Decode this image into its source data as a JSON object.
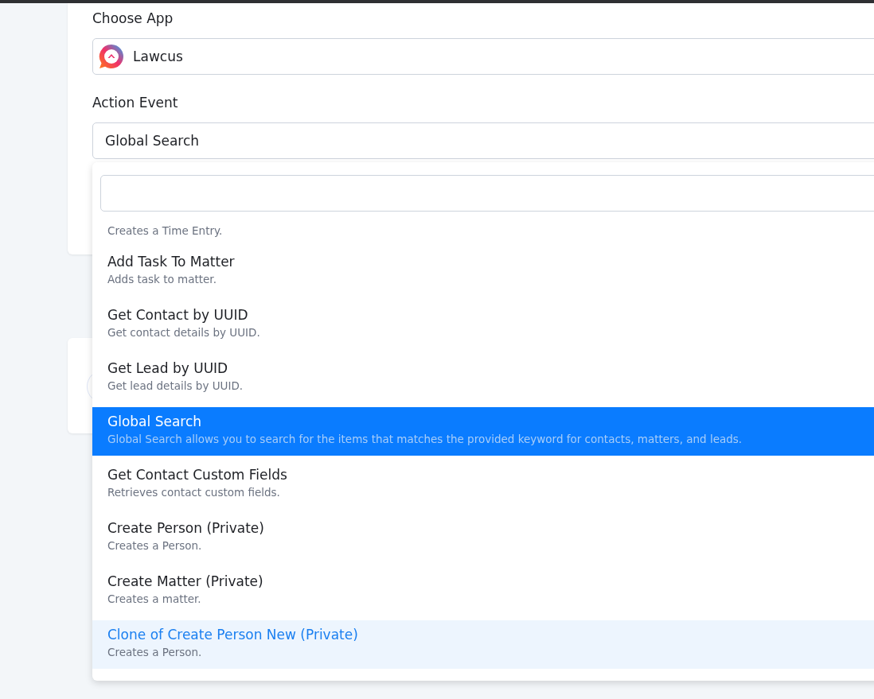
{
  "choose_app": {
    "label": "Choose App",
    "value": "Lawcus"
  },
  "action_event": {
    "label": "Action Event",
    "value": "Global Search"
  },
  "dropdown": {
    "options": [
      {
        "kind": "partial",
        "description": "Creates a Time Entry.",
        "selected": false,
        "highlighted": false
      },
      {
        "kind": "full",
        "title": "Add Task To Matter",
        "description": "Adds task to matter.",
        "selected": false,
        "highlighted": false
      },
      {
        "kind": "full",
        "title": "Get Contact by UUID",
        "description": "Get contact details by UUID.",
        "selected": false,
        "highlighted": false
      },
      {
        "kind": "full",
        "title": "Get Lead by UUID",
        "description": "Get lead details by UUID.",
        "selected": false,
        "highlighted": false
      },
      {
        "kind": "full",
        "title": "Global Search",
        "description": "Global Search allows you to search for the items that matches the provided keyword for contacts, matters, and leads.",
        "selected": true,
        "highlighted": false
      },
      {
        "kind": "full",
        "title": "Get Contact Custom Fields",
        "description": "Retrieves contact custom fields.",
        "selected": false,
        "highlighted": false
      },
      {
        "kind": "full",
        "title": "Create Person (Private)",
        "description": "Creates a Person.",
        "selected": false,
        "highlighted": false
      },
      {
        "kind": "full",
        "title": "Create Matter (Private)",
        "description": "Creates a matter.",
        "selected": false,
        "highlighted": false
      },
      {
        "kind": "full",
        "title": "Clone of Create Person New (Private)",
        "description": "Creates a Person.",
        "selected": false,
        "highlighted": true
      }
    ]
  }
}
